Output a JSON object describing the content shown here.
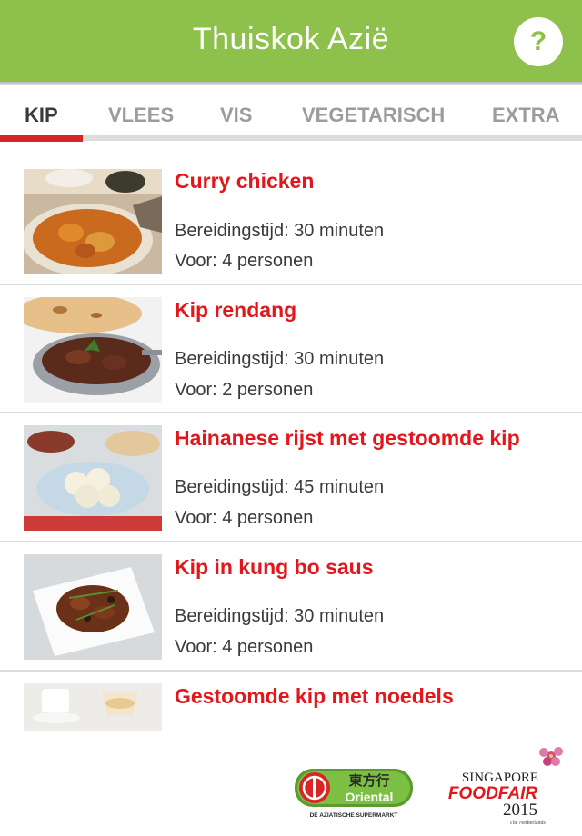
{
  "appbar": {
    "title": "Thuiskok Azië",
    "help_label": "?"
  },
  "tabs": [
    {
      "label": "KIP",
      "active": true
    },
    {
      "label": "VLEES",
      "active": false
    },
    {
      "label": "VIS",
      "active": false
    },
    {
      "label": "VEGETARISCH",
      "active": false
    },
    {
      "label": "EXTRA",
      "active": false
    }
  ],
  "recipes": [
    {
      "title": "Curry chicken",
      "time": "Bereidingstijd: 30 minuten",
      "persons": "Voor: 4 personen"
    },
    {
      "title": "Kip rendang",
      "time": "Bereidingstijd: 30 minuten",
      "persons": "Voor: 2 personen"
    },
    {
      "title": "Hainanese rijst met gestoomde kip",
      "time": "Bereidingstijd: 45 minuten",
      "persons": "Voor: 4 personen"
    },
    {
      "title": "Kip in kung bo saus",
      "time": "Bereidingstijd: 30 minuten",
      "persons": "Voor: 4 personen"
    },
    {
      "title": "Gestoomde kip met noedels"
    }
  ],
  "footer": {
    "oriental_logo": {
      "chinese": "東方行",
      "name": "Oriental",
      "tagline": "DÉ AZIATISCHE SUPERMARKT"
    },
    "foodfair_logo": {
      "line1": "SINGAPORE",
      "line2": "FOODFAIR",
      "year": "2015",
      "sub": "The Netherlands"
    }
  },
  "colors": {
    "appbar": "#8dc14b",
    "accent": "#d82626",
    "recipe_title": "#e3161b"
  }
}
